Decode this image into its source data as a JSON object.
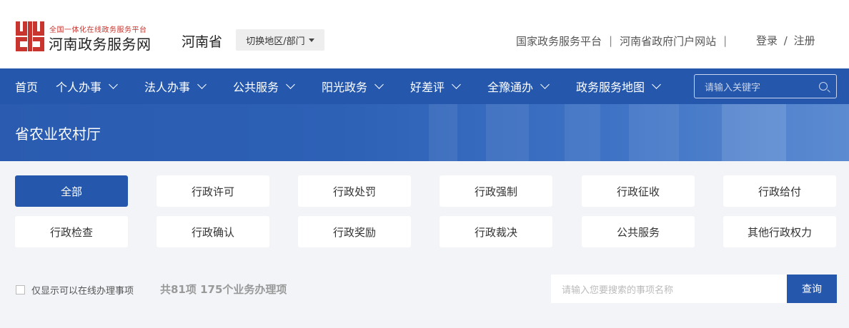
{
  "header": {
    "logo_subtitle": "全国一体化在线政务服务平台",
    "logo_title": "河南政务服务网",
    "region": "河南省",
    "switch_label": "切换地区/部门",
    "top_links": [
      "国家政务服务平台",
      "河南省政府门户网站"
    ],
    "separator": "|",
    "login": "登录",
    "slash": "/",
    "register": "注册",
    "brand_color": "#c8342e"
  },
  "nav": {
    "items": [
      {
        "label": "首页",
        "icon": ""
      },
      {
        "label": "个人办事",
        "icon": "chevron-down-icon"
      },
      {
        "label": "法人办事",
        "icon": "chevron-down-icon"
      },
      {
        "label": "公共服务",
        "icon": "chevron-down-icon"
      },
      {
        "label": "阳光政务",
        "icon": "chevron-down-icon"
      },
      {
        "label": "好差评",
        "icon": "chevron-down-icon"
      },
      {
        "label": "全豫通办",
        "icon": "chevron-down-icon"
      },
      {
        "label": "政务服务地图",
        "icon": "chevron-down-icon"
      }
    ],
    "search_placeholder": "请输入关键字",
    "color": "#2558ad"
  },
  "banner": {
    "title": "省农业农村厅"
  },
  "categories": {
    "items": [
      "全部",
      "行政许可",
      "行政处罚",
      "行政强制",
      "行政征收",
      "行政给付",
      "行政检查",
      "行政确认",
      "行政奖励",
      "行政裁决",
      "公共服务",
      "其他行政权力"
    ],
    "active": "全部"
  },
  "filter": {
    "online_only_label": "仅显示可以在线办理事项",
    "online_only_checked": false,
    "count_text": "共81项 175个业务办理项",
    "search_placeholder": "请输入您要搜索的事项名称",
    "query_label": "查询"
  }
}
